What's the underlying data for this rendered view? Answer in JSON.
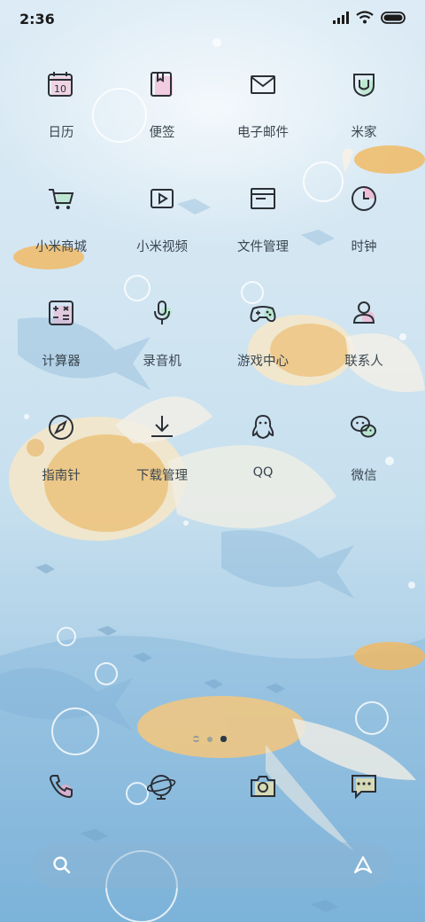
{
  "status_bar": {
    "time": "2:36"
  },
  "apps": [
    {
      "label": "日历",
      "icon": "calendar-icon",
      "badge_text": "10"
    },
    {
      "label": "便签",
      "icon": "notes-icon"
    },
    {
      "label": "电子邮件",
      "icon": "mail-icon"
    },
    {
      "label": "米家",
      "icon": "mijia-icon"
    },
    {
      "label": "小米商城",
      "icon": "cart-icon"
    },
    {
      "label": "小米视频",
      "icon": "video-icon"
    },
    {
      "label": "文件管理",
      "icon": "folder-icon"
    },
    {
      "label": "时钟",
      "icon": "clock-icon"
    },
    {
      "label": "计算器",
      "icon": "calculator-icon"
    },
    {
      "label": "录音机",
      "icon": "microphone-icon"
    },
    {
      "label": "游戏中心",
      "icon": "gamepad-icon"
    },
    {
      "label": "联系人",
      "icon": "contact-icon"
    },
    {
      "label": "指南针",
      "icon": "compass-icon"
    },
    {
      "label": "下载管理",
      "icon": "download-icon"
    },
    {
      "label": "QQ",
      "icon": "qq-icon"
    },
    {
      "label": "微信",
      "icon": "wechat-icon"
    }
  ],
  "pager": {
    "pages": 3,
    "current": 3
  },
  "dock": [
    {
      "icon": "phone-icon"
    },
    {
      "icon": "browser-icon"
    },
    {
      "icon": "camera-icon"
    },
    {
      "icon": "messages-icon"
    }
  ],
  "search_bar": {
    "left_icon": "search-icon",
    "right_icon": "assistant-icon"
  },
  "colors": {
    "icon_stroke": "#2b2f36",
    "pink_accent": "#f6a9c8",
    "green_accent": "#a9e6b8",
    "gold_fish": "#f2b85c"
  }
}
